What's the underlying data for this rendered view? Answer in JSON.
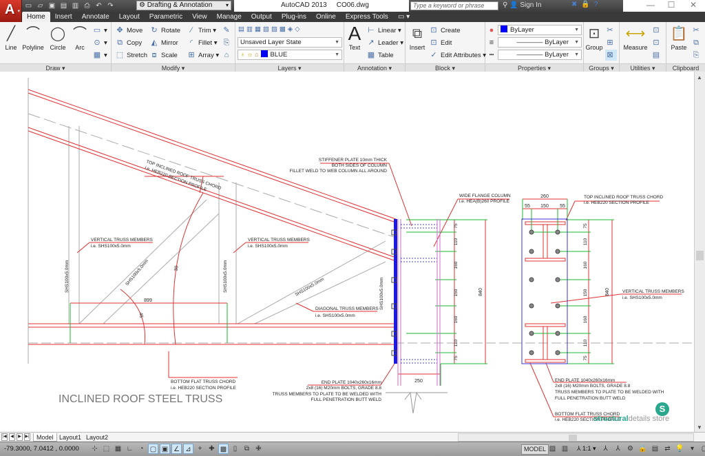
{
  "titlebar": {
    "app_logo": "A",
    "workspace": "Drafting & Annotation",
    "app_name": "AutoCAD 2013",
    "file_name": "CO06.dwg",
    "search_placeholder": "Type a keyword or phrase",
    "sign_in": "Sign In",
    "qat_icons": [
      "new-icon",
      "open-icon",
      "save-icon",
      "save-as-icon",
      "publish-icon",
      "print-icon",
      "undo-icon",
      "redo-icon"
    ],
    "window_controls": {
      "minimize": "—",
      "maximize": "☐",
      "close": "✕"
    }
  },
  "tabs": [
    "Home",
    "Insert",
    "Annotate",
    "Layout",
    "Parametric",
    "View",
    "Manage",
    "Output",
    "Plug-ins",
    "Online",
    "Express Tools"
  ],
  "active_tab": "Home",
  "ribbon": {
    "draw": {
      "title": "Draw",
      "line": "Line",
      "polyline": "Polyline",
      "circle": "Circle",
      "arc": "Arc"
    },
    "modify": {
      "title": "Modify",
      "move": "Move",
      "rotate": "Rotate",
      "trim": "Trim",
      "copy": "Copy",
      "mirror": "Mirror",
      "fillet": "Fillet",
      "stretch": "Stretch",
      "scale": "Scale",
      "array": "Array"
    },
    "layers": {
      "title": "Layers",
      "layer_state": "Unsaved Layer State",
      "current_layer": "BLUE",
      "current_layer_color": "#0000ff"
    },
    "annotation": {
      "title": "Annotation",
      "text": "Text",
      "linear": "Linear",
      "leader": "Leader",
      "table": "Table"
    },
    "block": {
      "title": "Block",
      "insert": "Insert",
      "create": "Create",
      "edit": "Edit",
      "edit_attributes": "Edit Attributes"
    },
    "properties": {
      "title": "Properties",
      "color": "ByLayer",
      "lineweight": "ByLayer",
      "linetype": "ByLayer"
    },
    "groups": {
      "title": "Groups",
      "group": "Group"
    },
    "utilities": {
      "title": "Utilities",
      "measure": "Measure"
    },
    "clipboard": {
      "title": "Clipboard",
      "paste": "Paste"
    }
  },
  "drawing": {
    "title": "INCLINED ROOF STEEL TRUSS",
    "labels": {
      "top_chord_1": "TOP INCLINED ROOF TRUSS CHORD",
      "top_chord_2": "i.e. HEB220 SECTION PROFILE",
      "vert_members_1": "VERTICAL TRUSS MEMBERS",
      "vert_members_2": "i.e. SHS100x5.0mm",
      "diag_members_1": "DIAGONAL TRUSS MEMBERS",
      "diag_members_2": "i.e. SHS100x5.0mm",
      "stiffener_1": "STIFFENER PLATE 10mm THICK",
      "stiffener_2": "BOTH SIDES OF COLUMN",
      "stiffener_3": "FILLET WELD TO WEB COLUMN ALL AROUND",
      "column_1": "WIDE FLANGE COLUMN",
      "column_2": "i.e. HEA(B)260 PROFILE",
      "bottom_chord_1": "BOTTOM FLAT TRUSS CHORD",
      "bottom_chord_2": "i.e. HEB220 SECTION PROFILE",
      "end_plate_1": "END PLATE 1040x260x16mm",
      "end_plate_2": "2x8 (16) M20mm BOLTS, GRADE 8.8",
      "end_plate_3": "TRUSS MEMBERS TO PLATE TO BE WELDED WITH",
      "end_plate_4": "FULL PENETRATION BUTT WELD",
      "member_size": "SHS100x5.0mm"
    },
    "dims": {
      "span": "899",
      "angle_a": "45",
      "angle_b": "30",
      "col_width": "250",
      "plate_height": "840",
      "bolt_spacing": [
        "75",
        "110",
        "160",
        "150",
        "160",
        "110",
        "75"
      ],
      "plate_width": "260",
      "plate_sub": [
        "55",
        "150",
        "55"
      ]
    }
  },
  "watermark": {
    "brand_bold": "structural",
    "brand_rest": "details store",
    "logo": "S"
  },
  "layout_tabs": [
    "Model",
    "Layout1",
    "Layout2"
  ],
  "status": {
    "coords": "-79.3000, 7.0412 , 0.0000",
    "model": "MODEL",
    "annotation_scale": "1:1"
  }
}
